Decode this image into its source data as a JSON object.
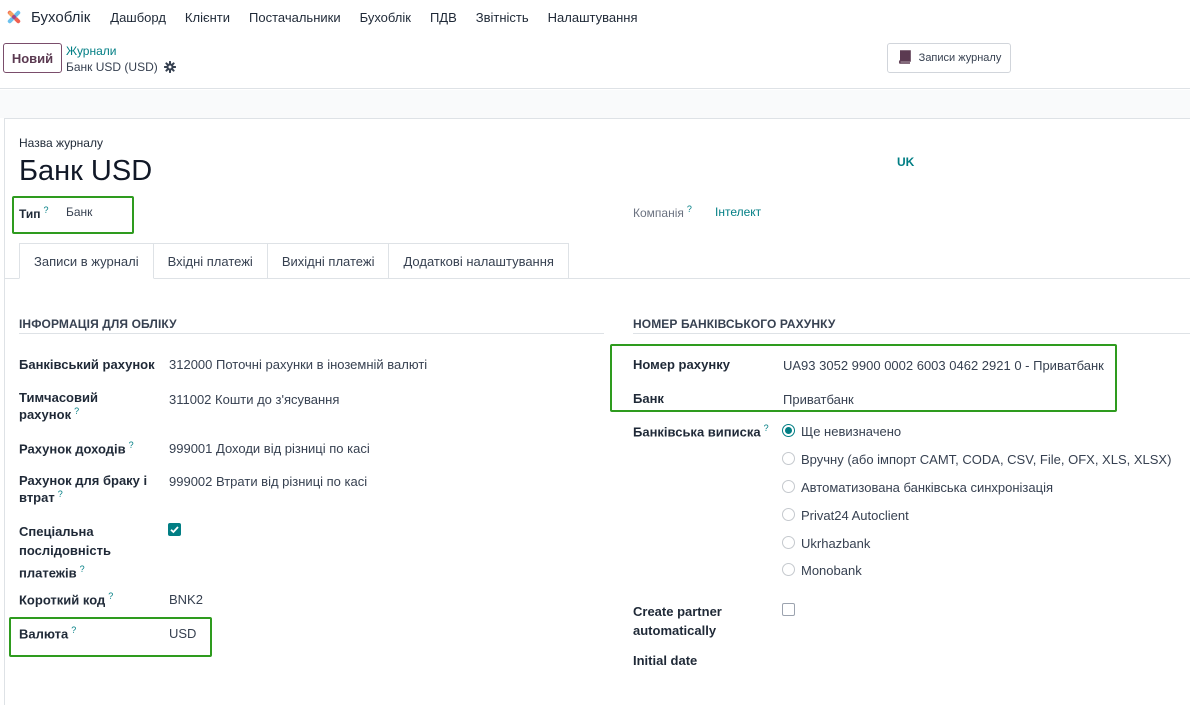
{
  "nav": {
    "app_name": "Бухоблік",
    "menu": [
      "Дашборд",
      "Клієнти",
      "Постачальники",
      "Бухоблік",
      "ПДВ",
      "Звітність",
      "Налаштування"
    ]
  },
  "control": {
    "new_button": "Новий",
    "breadcrumb_parent": "Журнали",
    "breadcrumb_current": "Банк USD (USD)",
    "journal_entries_button": "Записи журналу"
  },
  "form": {
    "name_label": "Назва журналу",
    "name_value": "Банк USD",
    "lang_badge": "UK",
    "type_label": "Тип",
    "type_value": "Банк",
    "company_label": "Компанія",
    "company_value": "Інтелект",
    "help_mark": "?"
  },
  "tabs": [
    "Записи в журналі",
    "Вхідні платежі",
    "Вихідні платежі",
    "Додаткові налаштування"
  ],
  "accounting": {
    "title": "ІНФОРМАЦІЯ ДЛЯ ОБЛІКУ",
    "bank_account_label": "Банківський рахунок",
    "bank_account_value": "312000 Поточні рахунки в іноземній валюті",
    "suspense_label_1": "Тимчасовий",
    "suspense_label_2": "рахунок",
    "suspense_value": "311002 Кошти до з'ясування",
    "profit_label": "Рахунок доходів",
    "profit_value": "999001 Доходи від різниці по касі",
    "loss_label_1": "Рахунок для браку і",
    "loss_label_2": "втрат",
    "loss_value": "999002 Втрати від різниці по касі",
    "seq_label_1": "Спеціальна",
    "seq_label_2": "послідовність",
    "seq_label_3": "платежів",
    "seq_checked": true,
    "code_label": "Короткий код",
    "code_value": "BNK2",
    "currency_label": "Валюта",
    "currency_value": "USD"
  },
  "bank": {
    "title": "НОМЕР БАНКІВСЬКОГО РАХУНКУ",
    "account_number_label": "Номер рахунку",
    "account_number_value": "UA93 3052 9900 0002 6003 0462 2921 0 - Приватбанк",
    "bank_label": "Банк",
    "bank_value": "Приватбанк",
    "statement_label": "Банківська виписка",
    "statement_options": [
      "Ще невизначено",
      "Вручну (або імпорт CAMT, CODA, CSV, File, OFX, XLS, XLSX)",
      "Автоматизована банківська синхронізація",
      "Privat24 Autoclient",
      "Ukrhazbank",
      "Monobank"
    ],
    "statement_selected": "Ще невизначено",
    "create_partner_label_1": "Create partner",
    "create_partner_label_2": "automatically",
    "create_partner_checked": false,
    "initial_date_label": "Initial date"
  },
  "colors": {
    "accent": "#017e84",
    "brand": "#714b67",
    "highlight_box": "#2e9b1e"
  }
}
